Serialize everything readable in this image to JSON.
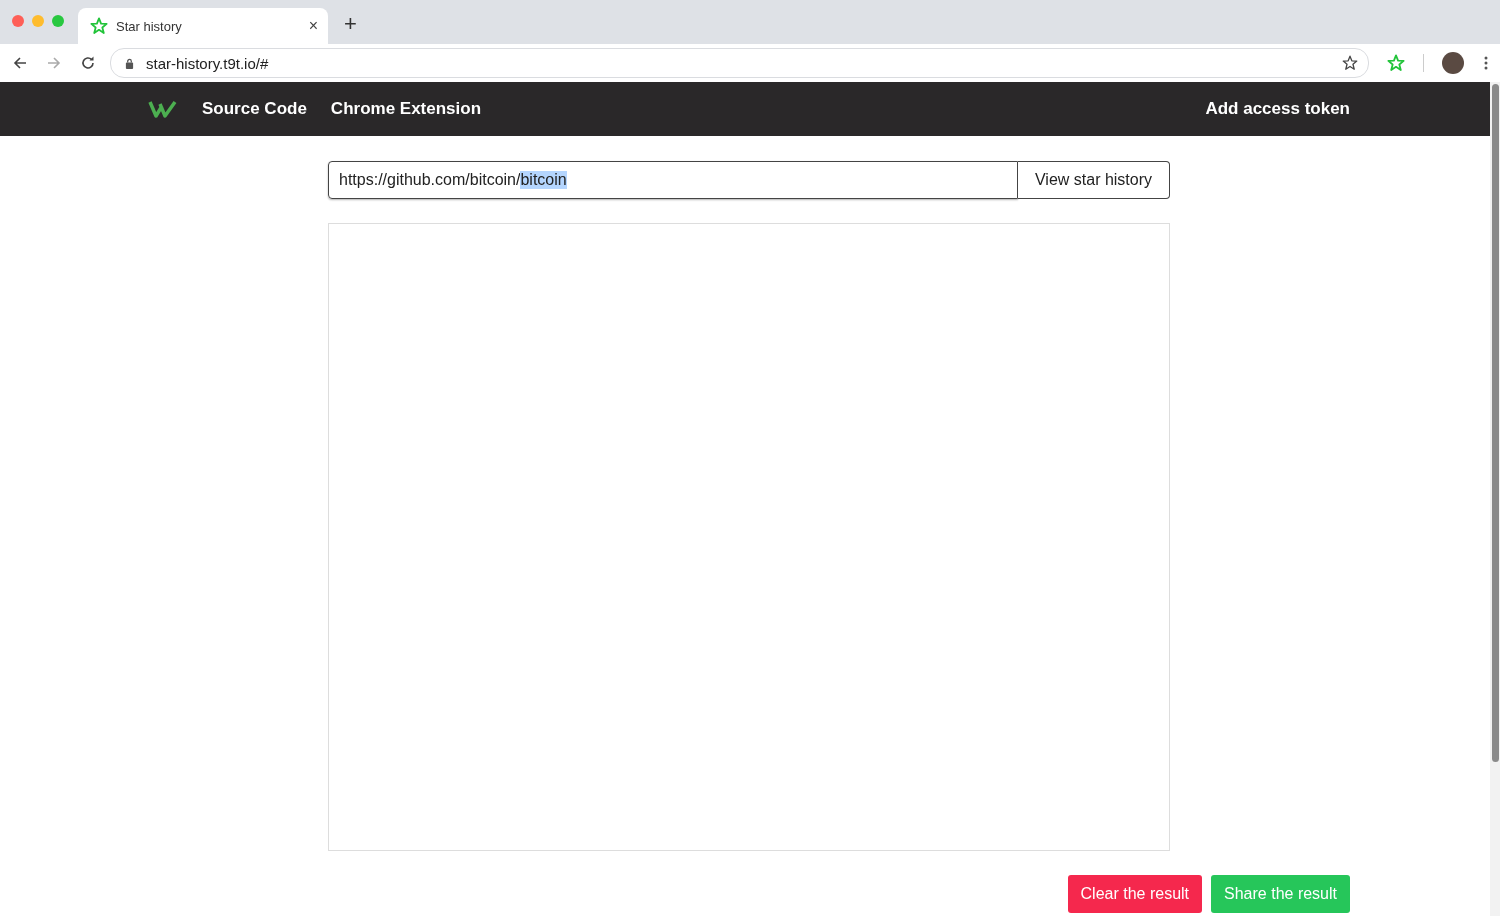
{
  "browser": {
    "tabs": [
      {
        "title": "Star history",
        "selected": true
      }
    ],
    "new_tab": "+",
    "close": "×",
    "address": "star-history.t9t.io/#"
  },
  "navbar": {
    "links": [
      "Source Code",
      "Chrome Extension"
    ],
    "right_link": "Add access token"
  },
  "search": {
    "value_parts": [
      {
        "text": "https://github.com/bitcoin/",
        "selected": false
      },
      {
        "text": "bitcoin",
        "selected": true
      }
    ],
    "button": "View star history"
  },
  "actions": [
    {
      "label": "Clear the result",
      "kind": "danger"
    },
    {
      "label": "Share the result",
      "kind": "success"
    }
  ]
}
